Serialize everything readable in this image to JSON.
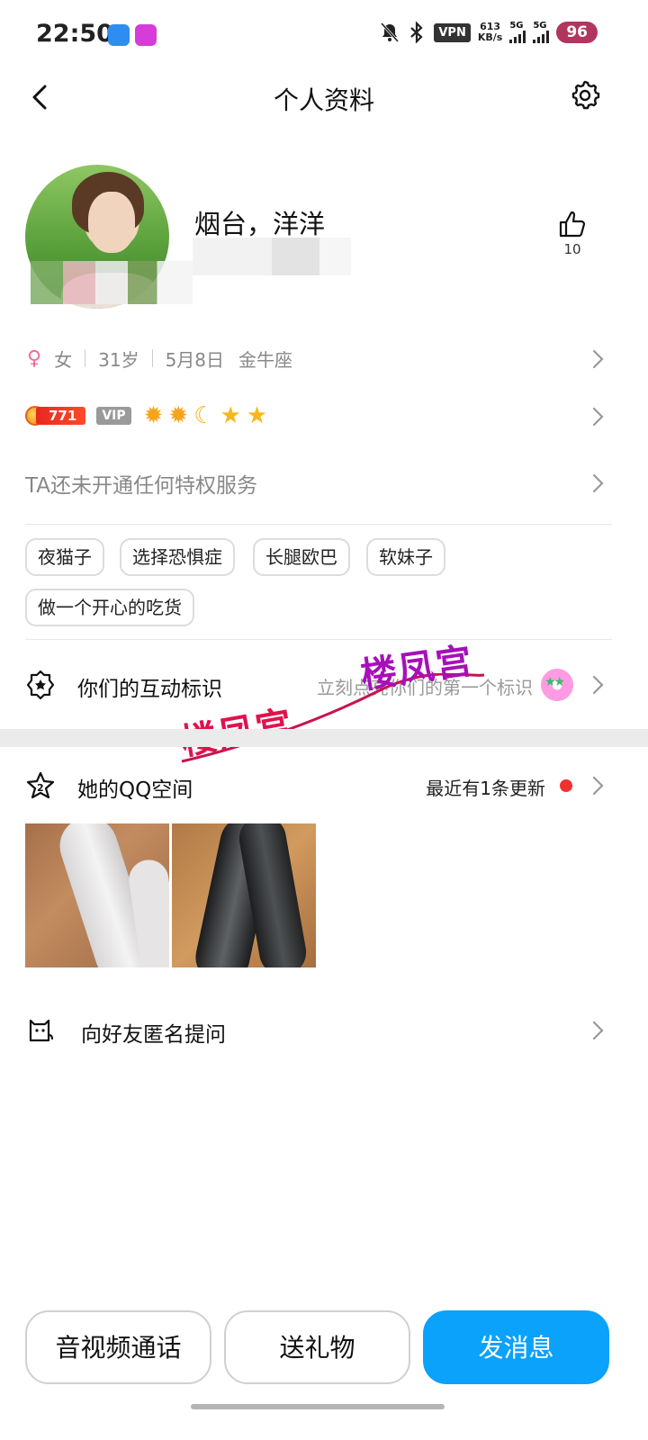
{
  "status_bar": {
    "time": "22:50",
    "vpn": "VPN",
    "net_speed_value": "613",
    "net_speed_unit": "KB/s",
    "signal1_label": "5G",
    "signal2_label": "5G",
    "battery": "96"
  },
  "header": {
    "title": "个人资料",
    "back_icon": "chevron-left-icon",
    "settings_icon": "gear-icon"
  },
  "profile": {
    "nickname": "烟台，洋洋",
    "likes": "10"
  },
  "info": {
    "gender_symbol": "♀",
    "gender": "女",
    "age": "31岁",
    "birthday": "5月8日",
    "zodiac": "金牛座"
  },
  "level": {
    "value": "771",
    "vip": "VIP",
    "crowns": [
      "sun",
      "sun",
      "moon",
      "star",
      "star"
    ]
  },
  "privilege_text": "TA还未开通任何特权服务",
  "tags": [
    "夜猫子",
    "选择恐惧症",
    "长腿欧巴",
    "软妹子",
    "做一个开心的吃货"
  ],
  "interaction": {
    "label": "你们的互动标识",
    "hint": "立刻点亮你们的第一个标识"
  },
  "qzone": {
    "label": "她的QQ空间",
    "update": "最近有1条更新"
  },
  "ask": {
    "label": "向好友匿名提问"
  },
  "watermark": "楼凤宫",
  "buttons": {
    "call": "音视频通话",
    "gift": "送礼物",
    "message": "发消息"
  },
  "colors": {
    "primary": "#0ba2fb",
    "level_badge": "#e8281e",
    "vip_badge": "#9a9a9a",
    "female": "#f06a9c",
    "update_dot": "#f23030",
    "watermark": "#e0124e"
  }
}
